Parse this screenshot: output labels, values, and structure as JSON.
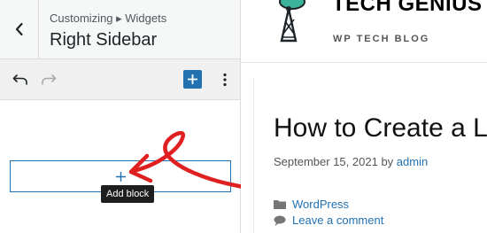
{
  "customizer": {
    "breadcrumb": "Customizing ▸ Widgets",
    "title": "Right Sidebar",
    "back_icon": "chevron-left-icon"
  },
  "toolbar": {
    "undo_icon": "undo-icon",
    "redo_icon": "redo-icon",
    "add_icon": "plus-icon",
    "more_icon": "vertical-ellipsis-icon",
    "accent_color": "#2271b1"
  },
  "widget_area": {
    "appender_icon": "plus-icon",
    "tooltip": "Add block"
  },
  "annotation": {
    "arrow_color": "#e02020"
  },
  "site": {
    "name": "TECH GENIUS",
    "tagline": "WP TECH BLOG",
    "logo_color": "#3bb39b"
  },
  "post": {
    "title": "How to Create a L",
    "date": "September 15, 2021",
    "by": "by",
    "author": "admin",
    "category": "WordPress",
    "comment_link": "Leave a comment"
  }
}
